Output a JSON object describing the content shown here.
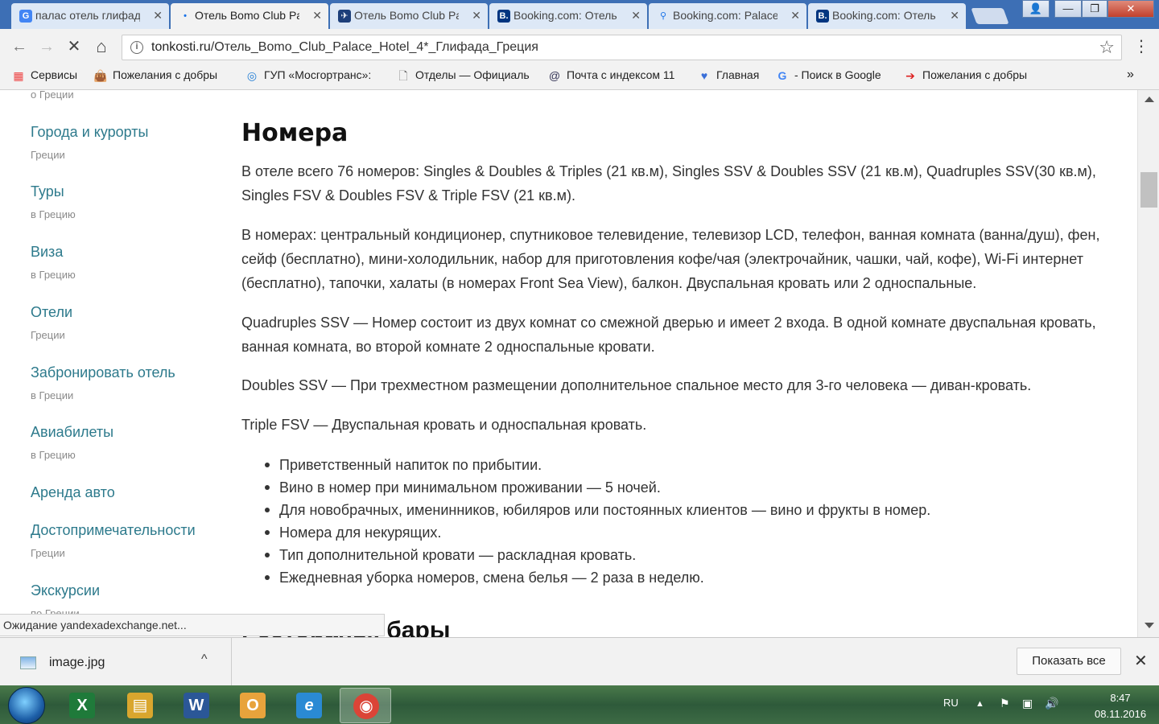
{
  "browser": {
    "tabs": [
      {
        "icon": "G",
        "icon_color": "#4285f4",
        "title": "палас отель глифада"
      },
      {
        "icon": "•",
        "icon_color": "#1a73e8",
        "title": "Отель Bomo Club Palace"
      },
      {
        "icon": "✈",
        "icon_color": "#1d3f7a",
        "title": "Отель Bomo Club Palace"
      },
      {
        "icon": "B.",
        "icon_color": "#003580",
        "title": "Booking.com: Отель"
      },
      {
        "icon": "⚲",
        "icon_color": "#1a73e8",
        "title": "Booking.com: Palace"
      },
      {
        "icon": "B.",
        "icon_color": "#003580",
        "title": "Booking.com: Отель"
      }
    ],
    "tab_close": "✕",
    "window_controls": {
      "user": "👤",
      "minimize": "—",
      "maximize": "❐",
      "close": "✕"
    },
    "nav": {
      "back": "←",
      "forward": "→",
      "reload": "✕",
      "home": "⌂",
      "menu": "⋮"
    },
    "address": {
      "host": "tonkosti.ru",
      "path": "/Отель_Bomo_Club_Palace_Hotel_4*_Глифада_Греция",
      "info": "i",
      "star": "☆"
    },
    "bookmarks": [
      {
        "icon": "▦",
        "icon_color": "#e44",
        "label": "Сервисы"
      },
      {
        "icon": "👜",
        "icon_color": "#b8860b",
        "label": "Пожелания с добры"
      },
      {
        "icon": "◎",
        "icon_color": "#1e7bd4",
        "label": "ГУП «Мосгортранс»:"
      },
      {
        "icon": "🗋",
        "icon_color": "#666",
        "label": "Отделы — Официаль"
      },
      {
        "icon": "@",
        "icon_color": "#335",
        "label": "Почта с индексом 11"
      },
      {
        "icon": "♥",
        "icon_color": "#3a6fd8",
        "label": "Главная"
      },
      {
        "icon": "G",
        "icon_color": "#4285f4",
        "label": "- Поиск в Google"
      },
      {
        "icon": "➔",
        "icon_color": "#d22",
        "label": "Пожелания с добры"
      }
    ],
    "bookmarks_more": "»",
    "status": "Ожидание yandexadexchange.net..."
  },
  "sidebar": {
    "top_sub": "о Греции",
    "items": [
      {
        "label": "Города и курорты",
        "sub": "Греции"
      },
      {
        "label": "Туры",
        "sub": "в Грецию"
      },
      {
        "label": "Виза",
        "sub": "в Грецию"
      },
      {
        "label": "Отели",
        "sub": "Греции"
      },
      {
        "label": "Забронировать отель",
        "sub": "в Греции"
      },
      {
        "label": "Авиабилеты",
        "sub": "в Грецию"
      },
      {
        "label": "Аренда авто",
        "sub": ""
      },
      {
        "label": "Достопримечательности",
        "sub": "Греции"
      },
      {
        "label": "Экскурсии",
        "sub": "по Греции"
      }
    ]
  },
  "main": {
    "heading": "Номера",
    "paragraphs": [
      "В отеле всего 76 номеров: Singles & Doubles & Triples (21 кв.м), Singles SSV & Doubles SSV (21 кв.м), Quadruples SSV(30 кв.м), Singles FSV & Doubles FSV & Triple FSV (21 кв.м).",
      "В номерах: центральный кондиционер, спутниковое телевидение, телевизор LCD, телефон, ванная комната (ванна/душ), фен, сейф (бесплатно), мини-холодильник, набор для приготовления кофе/чая (электрочайник, чашки, чай, кофе), Wi-Fi интернет (бесплатно), тапочки, халаты (в номерах Front Sea View), балкон. Двуспальная кровать или 2 односпальные.",
      "Quadruples SSV — Номер состоит из двух комнат со смежной дверью и имеет 2 входа. В одной комнате двуспальная кровать, ванная комната, во второй комнате 2 односпальные кровати.",
      "Doubles SSV — При трехместном размещении дополнительное спальное место для 3-го человека — диван-кровать.",
      "Triple FSV — Двуспальная кровать и односпальная кровать."
    ],
    "bullets": [
      "Приветственный напиток по прибытии.",
      "Вино в номер при минимальном проживании — 5 ночей.",
      "Для новобрачных, именинников, юбиляров или постоянных клиентов — вино и фрукты в номер.",
      "Номера для некурящих.",
      "Тип дополнительной кровати — раскладная кровать.",
      "Ежедневная уборка номеров, смена белья — 2 раза в неделю."
    ],
    "next_heading": "Рестораны, бары"
  },
  "downloads": {
    "file_name": "image.jpg",
    "chevron": "^",
    "show_all": "Показать все",
    "close": "✕"
  },
  "taskbar": {
    "apps": [
      {
        "icon": "X",
        "color": "#1f7a3a",
        "name": "Excel"
      },
      {
        "icon": "▤",
        "color": "#d9a62e",
        "name": "Explorer"
      },
      {
        "icon": "W",
        "color": "#2b5797",
        "name": "Word"
      },
      {
        "icon": "O",
        "color": "#e8a33c",
        "name": "Outlook"
      },
      {
        "icon": "e",
        "color": "#2a8ad4",
        "name": "Internet Explorer"
      },
      {
        "icon": "◉",
        "color": "#db4437",
        "name": "Chrome"
      }
    ],
    "lang": "RU",
    "tray_icons": [
      "▲",
      "⚑",
      "▣",
      "🔊"
    ],
    "time": "8:47",
    "date": "08.11.2016"
  }
}
